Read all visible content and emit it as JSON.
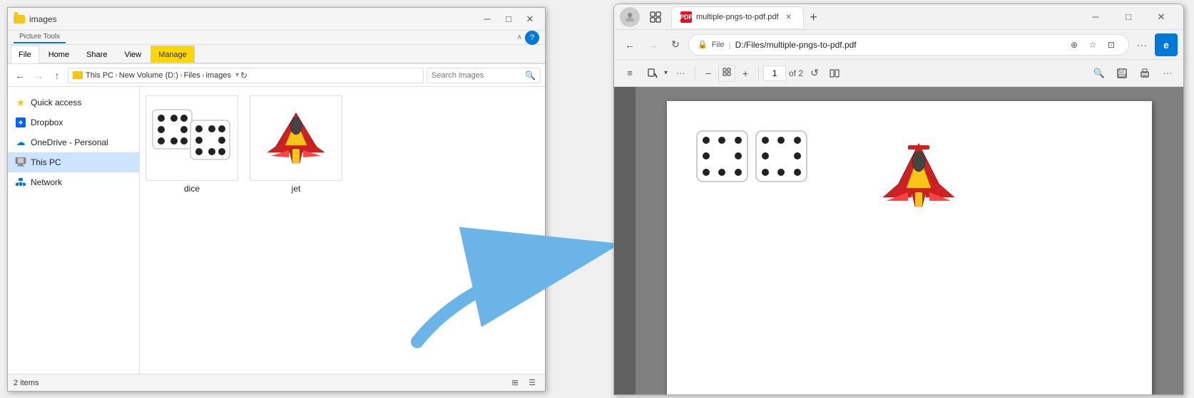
{
  "explorer": {
    "title": "images",
    "title_bar": {
      "icon_label": "folder",
      "manage_label": "Manage",
      "file_tab": "File",
      "home_tab": "Home",
      "share_tab": "Share",
      "view_tab": "View",
      "picture_tools_tab": "Picture Tools",
      "minimize": "─",
      "maximize": "□",
      "close": "✕"
    },
    "address_bar": {
      "breadcrumb": "This PC  ›  New Volume (D:)  ›  Files  ›  images",
      "search_placeholder": "Search images",
      "search_icon": "🔍"
    },
    "sidebar": {
      "quick_access": "Quick access",
      "dropbox": "Dropbox",
      "onedrive": "OneDrive - Personal",
      "this_pc": "This PC",
      "network": "Network"
    },
    "files": [
      {
        "name": "dice",
        "type": "image"
      },
      {
        "name": "jet",
        "type": "image"
      }
    ],
    "status": {
      "items": "2 items",
      "view1": "⊞",
      "view2": "☰"
    }
  },
  "browser": {
    "tab": {
      "title": "multiple-pngs-to-pdf.pdf",
      "close": "✕"
    },
    "new_tab_btn": "+",
    "window_controls": {
      "minimize": "─",
      "maximize": "□",
      "close": "✕"
    },
    "address_bar": {
      "back": "←",
      "forward": "→",
      "refresh": "↻",
      "protocol": "File",
      "url": "D:/Files/multiple-pngs-to-pdf.pdf",
      "zoom_icon": "⊕",
      "star_icon": "☆",
      "read_icon": "⊡",
      "more": "···"
    },
    "pdf_toolbar": {
      "outline_icon": "≡",
      "highlight_icon": "✏",
      "more_icon": "···",
      "zoom_out": "−",
      "zoom_in": "+",
      "fit_page": "⊡",
      "page_current": "1",
      "page_total": "of 2",
      "rotate": "↺",
      "dual_page": "⊞",
      "search": "🔍",
      "save": "💾",
      "print": "🖨",
      "more2": "···",
      "edge_icon": "🔵"
    }
  },
  "arrow": {
    "label": "blue curved arrow pointing right"
  }
}
